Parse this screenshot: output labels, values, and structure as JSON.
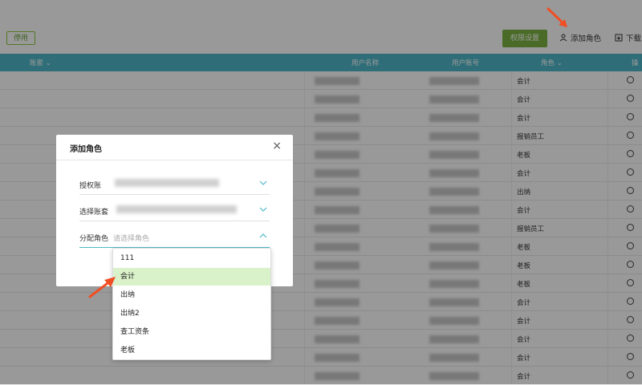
{
  "toolbar": {
    "disable_label": "停用",
    "permission_label": "权限设置",
    "add_role_label": "添加角色",
    "download_label": "下载"
  },
  "table": {
    "headers": {
      "account": "账套",
      "user_name": "用户名称",
      "user_no": "用户账号",
      "role": "角色",
      "op": "操"
    },
    "roles": [
      "会计",
      "会计",
      "会计",
      "报销员工",
      "老板",
      "会计",
      "出纳",
      "会计",
      "报销员工",
      "老板",
      "老板",
      "老板",
      "会计",
      "会计",
      "会计",
      "会计",
      "会计"
    ]
  },
  "modal": {
    "title": "添加角色",
    "close": "×",
    "authorized_label": "授权账",
    "select_account_label": "选择账套",
    "assign_role_label": "分配角色",
    "assign_role_placeholder": "请选择角色"
  },
  "dropdown": {
    "options": [
      "111",
      "会计",
      "出纳",
      "出纳2",
      "查工资条",
      "老板"
    ],
    "selected": "会计"
  },
  "colors": {
    "accent": "#7cb342",
    "header": "#4fb8c9",
    "selected_bg": "#d9f2c9",
    "arrow": "#f04e23"
  }
}
